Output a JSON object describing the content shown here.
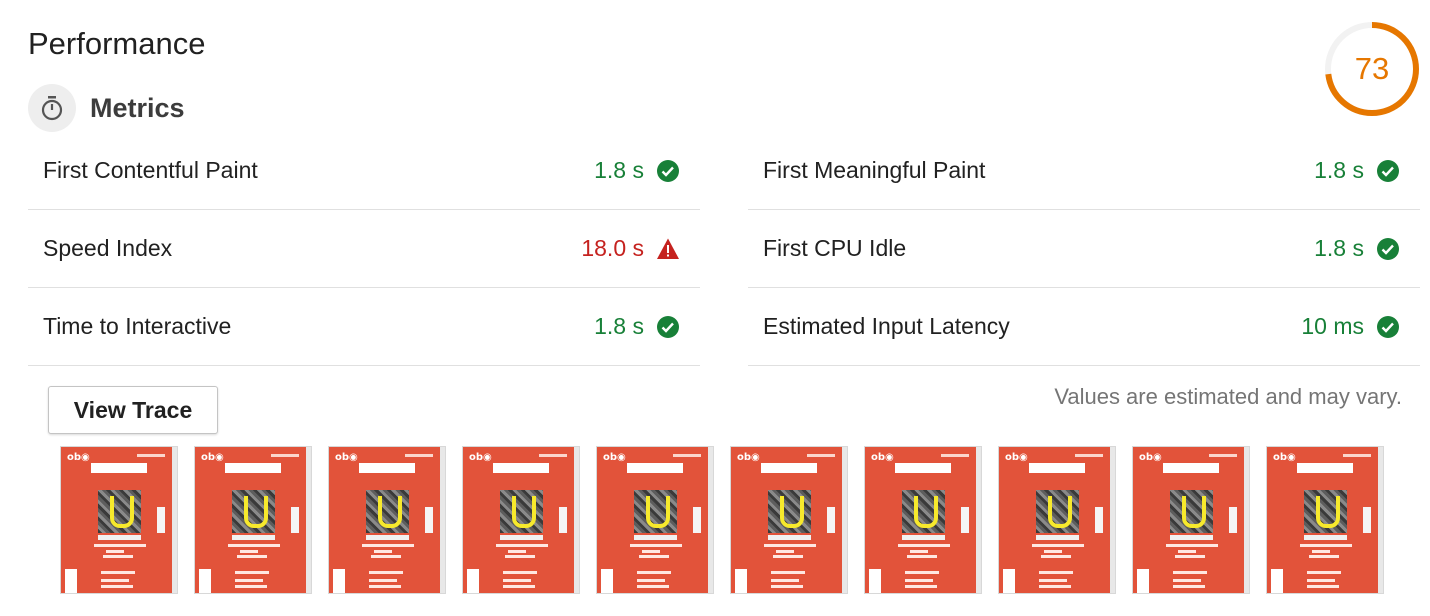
{
  "section": {
    "title": "Performance"
  },
  "score": {
    "value": "73",
    "fraction": 0.73,
    "color": "#e67700"
  },
  "metrics": {
    "heading": "Metrics",
    "left": [
      {
        "label": "First Contentful Paint",
        "value": "1.8 s",
        "status": "pass"
      },
      {
        "label": "Speed Index",
        "value": "18.0 s",
        "status": "fail"
      },
      {
        "label": "Time to Interactive",
        "value": "1.8 s",
        "status": "pass"
      }
    ],
    "right": [
      {
        "label": "First Meaningful Paint",
        "value": "1.8 s",
        "status": "pass"
      },
      {
        "label": "First CPU Idle",
        "value": "1.8 s",
        "status": "pass"
      },
      {
        "label": "Estimated Input Latency",
        "value": "10 ms",
        "status": "pass"
      }
    ]
  },
  "actions": {
    "view_trace_label": "View Trace"
  },
  "note": "Values are estimated and may vary.",
  "filmstrip": {
    "frame_count": 10
  },
  "colors": {
    "pass": "#188038",
    "fail": "#c5221f",
    "average": "#e67700",
    "frame_bg": "#e2533a"
  },
  "icons": {
    "pass": "check-circle-icon",
    "fail": "warning-triangle-icon",
    "metrics": "stopwatch-icon"
  }
}
